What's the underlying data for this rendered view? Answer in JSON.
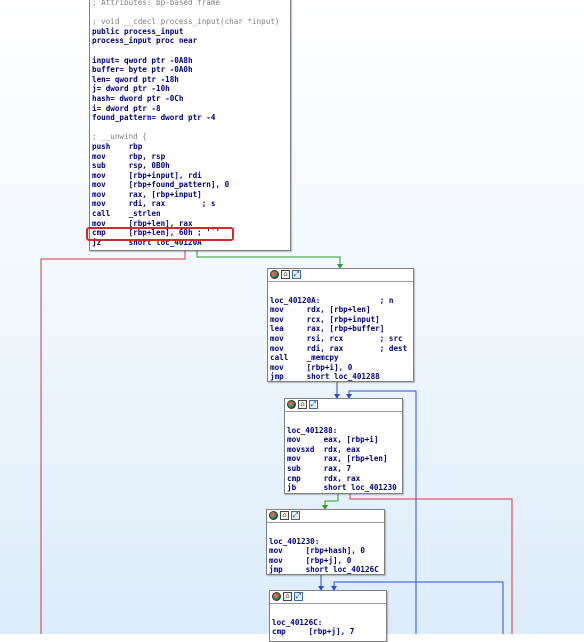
{
  "colors": {
    "edge_true": "#2a9a2a",
    "edge_false": "#d23a3a",
    "edge_jump": "#2a4fd6",
    "highlight": "#d02b2b"
  },
  "icons": [
    "graph-color-icon",
    "graph-node-icon",
    "zoom-node-icon"
  ],
  "main_block": {
    "lines": [
      "; Attributes: bp-based frame",
      "",
      "; void __cdecl process_input(char *input)",
      "public process_input",
      "process_input proc near",
      "",
      "input= qword ptr -0A8h",
      "buffer= byte ptr -0A0h",
      "len= qword ptr -18h",
      "j= dword ptr -10h",
      "hash= dword ptr -0Ch",
      "i= dword ptr -8",
      "found_pattern= dword ptr -4",
      "",
      "; __unwind {",
      "push    rbp",
      "mov     rbp, rsp",
      "sub     rsp, 0B0h",
      "mov     [rbp+input], rdi",
      "mov     [rbp+found_pattern], 0",
      "mov     rax, [rbp+input]",
      "mov     rdi, rax        ; s",
      "call    _strlen",
      "mov     [rbp+len], rax",
      "cmp     [rbp+len], 60h ; '`'",
      "jz      short loc_40120A"
    ]
  },
  "block_40120A": {
    "lines": [
      "",
      "loc_40120A:             ; n",
      "mov     rdx, [rbp+len]",
      "mov     rcx, [rbp+input]",
      "lea     rax, [rbp+buffer]",
      "mov     rsi, rcx        ; src",
      "mov     rdi, rax        ; dest",
      "call    _memcpy",
      "mov     [rbp+i], 0",
      "jmp     short loc_401288"
    ]
  },
  "block_401288": {
    "lines": [
      "",
      "loc_401288:",
      "mov     eax, [rbp+i]",
      "movsxd  rdx, eax",
      "mov     rax, [rbp+len]",
      "sub     rax, 7",
      "cmp     rdx, rax",
      "jb      short loc_401230"
    ]
  },
  "block_401230": {
    "lines": [
      "",
      "loc_401230:",
      "mov     [rbp+hash], 0",
      "mov     [rbp+j], 0",
      "jmp     short loc_40126C"
    ]
  },
  "block_40126C": {
    "lines": [
      "",
      "loc_40126C:",
      "cmp     [rbp+j], 7"
    ]
  }
}
